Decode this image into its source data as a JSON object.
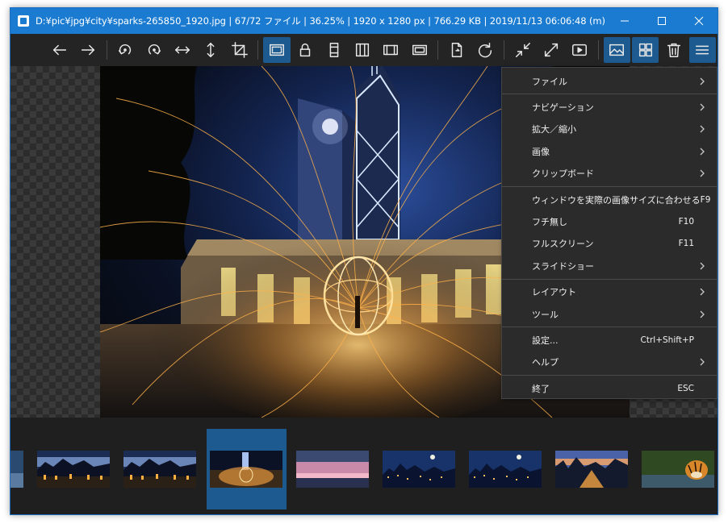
{
  "window": {
    "title": "D:¥pic¥jpg¥city¥sparks-265850_1920.jpg  |  67/72 ファイル  |  36.25%  |  1920 x 1280 px  |  766.29 KB  |  2019/11/13 06:06:48 (m)  - ImageGlass",
    "accent_color": "#1a7bd1"
  },
  "toolbar": {
    "buttons": [
      {
        "name": "previous-image",
        "icon": "arrow-left-icon",
        "active": false
      },
      {
        "name": "next-image",
        "icon": "arrow-right-icon",
        "active": false
      },
      {
        "name": "rotate-left",
        "icon": "rotate-left-icon",
        "active": false
      },
      {
        "name": "rotate-right",
        "icon": "rotate-right-icon",
        "active": false
      },
      {
        "name": "flip-horizontal",
        "icon": "flip-horizontal-icon",
        "active": false
      },
      {
        "name": "flip-vertical",
        "icon": "flip-vertical-icon",
        "active": false
      },
      {
        "name": "crop",
        "icon": "crop-icon",
        "active": false
      },
      {
        "name": "auto-zoom",
        "icon": "auto-zoom-icon",
        "active": true
      },
      {
        "name": "lock-zoom",
        "icon": "lock-icon",
        "active": false
      },
      {
        "name": "scale-to-width",
        "icon": "scale-width-icon",
        "active": false
      },
      {
        "name": "scale-to-height",
        "icon": "scale-height-icon",
        "active": false
      },
      {
        "name": "scale-to-fit",
        "icon": "scale-fit-icon",
        "active": false
      },
      {
        "name": "scale-to-fill",
        "icon": "scale-fill-icon",
        "active": false
      },
      {
        "name": "open-file",
        "icon": "file-open-icon",
        "active": false
      },
      {
        "name": "refresh",
        "icon": "refresh-icon",
        "active": false
      },
      {
        "name": "window-fit",
        "icon": "shrink-icon",
        "active": false
      },
      {
        "name": "fullscreen",
        "icon": "expand-icon",
        "active": false
      },
      {
        "name": "slideshow",
        "icon": "slideshow-icon",
        "active": false
      },
      {
        "name": "show-viewer",
        "icon": "image-icon",
        "active": true
      },
      {
        "name": "show-thumbnails",
        "icon": "grid-icon",
        "active": true
      },
      {
        "name": "delete",
        "icon": "trash-icon",
        "active": false
      },
      {
        "name": "main-menu",
        "icon": "hamburger-icon",
        "active": true
      }
    ]
  },
  "context_menu": {
    "groups": [
      [
        {
          "label": "ファイル",
          "shortcut": "",
          "submenu": true
        }
      ],
      [
        {
          "label": "ナビゲーション",
          "shortcut": "",
          "submenu": true
        },
        {
          "label": "拡大／縮小",
          "shortcut": "",
          "submenu": true
        },
        {
          "label": "画像",
          "shortcut": "",
          "submenu": true
        },
        {
          "label": "クリップボード",
          "shortcut": "",
          "submenu": true
        }
      ],
      [
        {
          "label": "ウィンドウを実際の画像サイズに合わせる",
          "shortcut": "F9",
          "submenu": false
        },
        {
          "label": "フチ無し",
          "shortcut": "F10",
          "submenu": false
        },
        {
          "label": "フルスクリーン",
          "shortcut": "F11",
          "submenu": false
        },
        {
          "label": "スライドショー",
          "shortcut": "",
          "submenu": true
        }
      ],
      [
        {
          "label": "レイアウト",
          "shortcut": "",
          "submenu": true
        },
        {
          "label": "ツール",
          "shortcut": "",
          "submenu": true
        }
      ],
      [
        {
          "label": "設定...",
          "shortcut": "Ctrl+Shift+P",
          "submenu": false
        },
        {
          "label": "ヘルプ",
          "shortcut": "",
          "submenu": true
        }
      ],
      [
        {
          "label": "終了",
          "shortcut": "ESC",
          "submenu": false
        }
      ]
    ]
  },
  "thumbnails": [
    {
      "kind": "partial-blue",
      "selected": false
    },
    {
      "kind": "harbor-night",
      "selected": false
    },
    {
      "kind": "harbor-night",
      "selected": false
    },
    {
      "kind": "sparks",
      "selected": true
    },
    {
      "kind": "pink-sky",
      "selected": false
    },
    {
      "kind": "city-moon",
      "selected": false
    },
    {
      "kind": "city-moon",
      "selected": false
    },
    {
      "kind": "city-traffic",
      "selected": false
    },
    {
      "kind": "tiger",
      "selected": false
    }
  ],
  "colors": {
    "window_bg": "#1f1f1f",
    "toolbar_bg": "#242424",
    "active_button": "#1d5a8f",
    "menu_bg": "#2b2b2b",
    "menu_text": "#f0f0f0"
  }
}
